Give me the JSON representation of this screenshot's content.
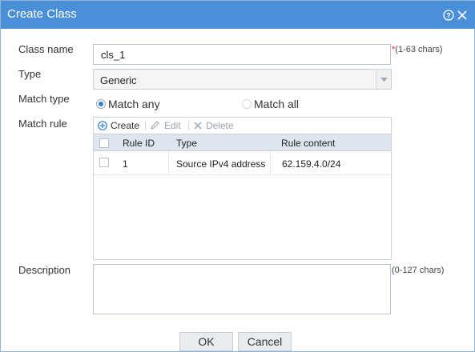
{
  "dialog": {
    "title": "Create Class"
  },
  "form": {
    "class_name": {
      "label": "Class name",
      "value": "cls_1",
      "required_mark": "*",
      "hint": "(1-63 chars)"
    },
    "type": {
      "label": "Type",
      "selected": "Generic"
    },
    "match_type": {
      "label": "Match type",
      "options": [
        {
          "label": "Match any",
          "checked": true
        },
        {
          "label": "Match all",
          "checked": false
        }
      ]
    },
    "match_rule": {
      "label": "Match rule",
      "toolbar": {
        "create": "Create",
        "edit": "Edit",
        "delete": "Delete"
      },
      "columns": [
        "Rule ID",
        "Type",
        "Rule content"
      ],
      "rows": [
        {
          "rule_id": "1",
          "type": "Source IPv4 address",
          "content": "62.159.4.0/24"
        }
      ]
    },
    "description": {
      "label": "Description",
      "value": "",
      "hint": "(0-127 chars)"
    }
  },
  "buttons": {
    "ok": "OK",
    "cancel": "Cancel"
  },
  "colors": {
    "titlebar": "#4a90d9",
    "radio_selected": "#2f7fd0",
    "create_icon": "#2f7fd0",
    "disabled_tool": "#9aa6b2",
    "grid_header": "#dde6ee"
  }
}
